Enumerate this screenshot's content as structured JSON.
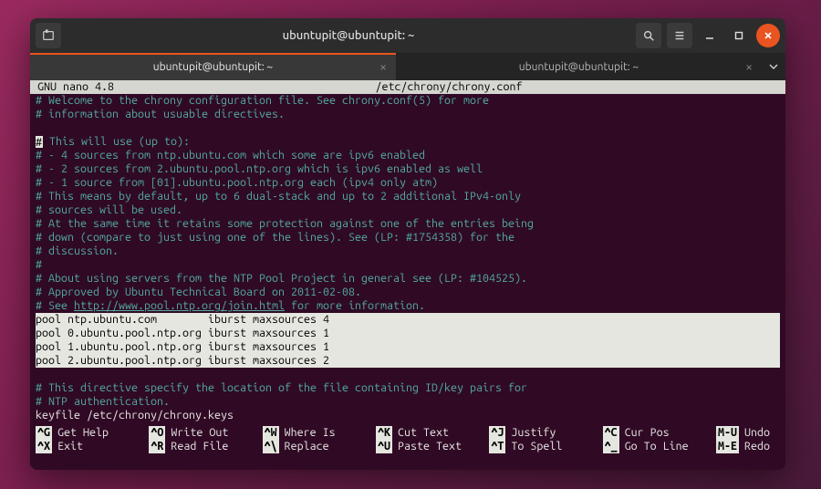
{
  "titlebar": {
    "title": "ubuntupit@ubuntupit: ~"
  },
  "tabs": [
    {
      "label": "ubuntupit@ubuntupit: ~"
    },
    {
      "label": "ubuntupit@ubuntupit: ~"
    }
  ],
  "nano": {
    "app": "GNU nano 4.8",
    "filepath": "/etc/chrony/chrony.conf",
    "modified": "",
    "body": {
      "l01": "# Welcome to the chrony configuration file. See chrony.conf(5) for more",
      "l02": "# information about usuable directives.",
      "l03": "",
      "l04a": "#",
      "l04b": " This will use (up to):",
      "l05": "# - 4 sources from ntp.ubuntu.com which some are ipv6 enabled",
      "l06": "# - 2 sources from 2.ubuntu.pool.ntp.org which is ipv6 enabled as well",
      "l07": "# - 1 source from [01].ubuntu.pool.ntp.org each (ipv4 only atm)",
      "l08": "# This means by default, up to 6 dual-stack and up to 2 additional IPv4-only",
      "l09": "# sources will be used.",
      "l10": "# At the same time it retains some protection against one of the entries being",
      "l11": "# down (compare to just using one of the lines). See (LP: #1754358) for the",
      "l12": "# discussion.",
      "l13": "#",
      "l14": "# About using servers from the NTP Pool Project in general see (LP: #104525).",
      "l15": "# Approved by Ubuntu Technical Board on 2011-02-08.",
      "l16a": "# See ",
      "l16b": "http://www.pool.ntp.org/join.html",
      "l16c": " for more information.",
      "h1": "pool ntp.ubuntu.com        iburst maxsources 4",
      "h2": "pool 0.ubuntu.pool.ntp.org iburst maxsources 1",
      "h3": "pool 1.ubuntu.pool.ntp.org iburst maxsources 1",
      "h4": "pool 2.ubuntu.pool.ntp.org iburst maxsources 2",
      "l17": "",
      "l18": "# This directive specify the location of the file containing ID/key pairs for",
      "l19": "# NTP authentication.",
      "l20": "keyfile /etc/chrony/chrony.keys"
    },
    "shortcuts": {
      "r1": [
        {
          "k": "^G",
          "t": "Get Help"
        },
        {
          "k": "^O",
          "t": "Write Out"
        },
        {
          "k": "^W",
          "t": "Where Is"
        },
        {
          "k": "^K",
          "t": "Cut Text"
        },
        {
          "k": "^J",
          "t": "Justify"
        },
        {
          "k": "^C",
          "t": "Cur Pos"
        }
      ],
      "r1x": {
        "k": "M-U",
        "t": "Undo"
      },
      "r2": [
        {
          "k": "^X",
          "t": "Exit"
        },
        {
          "k": "^R",
          "t": "Read File"
        },
        {
          "k": "^\\",
          "t": "Replace"
        },
        {
          "k": "^U",
          "t": "Paste Text"
        },
        {
          "k": "^T",
          "t": "To Spell"
        },
        {
          "k": "^_",
          "t": "Go To Line"
        }
      ],
      "r2x": {
        "k": "M-E",
        "t": "Redo"
      }
    }
  }
}
